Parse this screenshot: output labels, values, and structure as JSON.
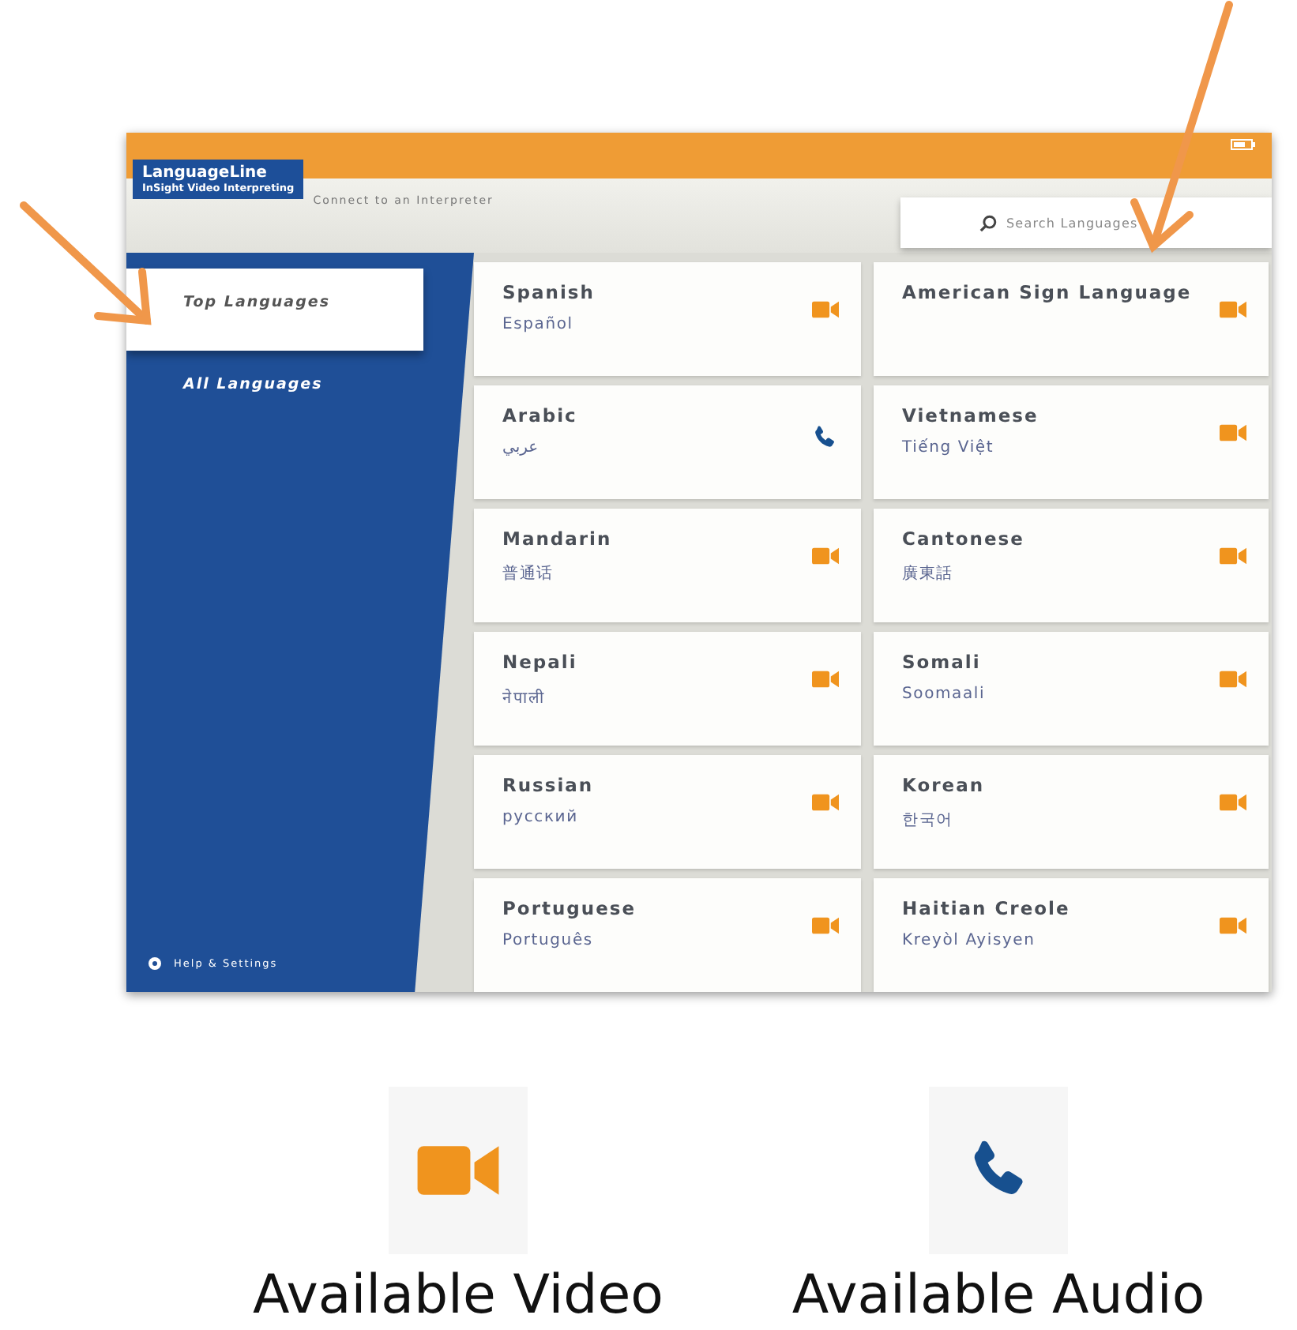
{
  "app": {
    "logo": {
      "name": "LanguageLine",
      "tagline": "InSight Video Interpreting"
    },
    "subtitle": "Connect to an Interpreter",
    "search": {
      "placeholder": "Search Languages"
    },
    "sidebar": {
      "items": [
        {
          "label": "Top Languages",
          "selected": true
        },
        {
          "label": "All Languages",
          "selected": false
        }
      ],
      "footer": "Help & Settings"
    },
    "languages": [
      {
        "name": "Spanish",
        "native": "Español",
        "kind": "video"
      },
      {
        "name": "American Sign Language",
        "kind": "video"
      },
      {
        "name": "Arabic",
        "native": "عربي",
        "kind": "audio"
      },
      {
        "name": "Vietnamese",
        "native": "Tiếng Việt",
        "kind": "video"
      },
      {
        "name": "Mandarin",
        "native": "普通话",
        "kind": "video"
      },
      {
        "name": "Cantonese",
        "native": "廣東話",
        "kind": "video"
      },
      {
        "name": "Nepali",
        "native": "नेपाली",
        "kind": "video"
      },
      {
        "name": "Somali",
        "native": "Soomaali",
        "kind": "video"
      },
      {
        "name": "Russian",
        "native": "русский",
        "kind": "video"
      },
      {
        "name": "Korean",
        "native": "한국어",
        "kind": "video"
      },
      {
        "name": "Portuguese",
        "native": "Português",
        "kind": "video"
      },
      {
        "name": "Haitian Creole",
        "native": "Kreyòl Ayisyen",
        "kind": "video"
      }
    ]
  },
  "legend": [
    {
      "label": "Available Video",
      "kind": "video"
    },
    {
      "label": "Available Audio",
      "kind": "audio"
    }
  ]
}
